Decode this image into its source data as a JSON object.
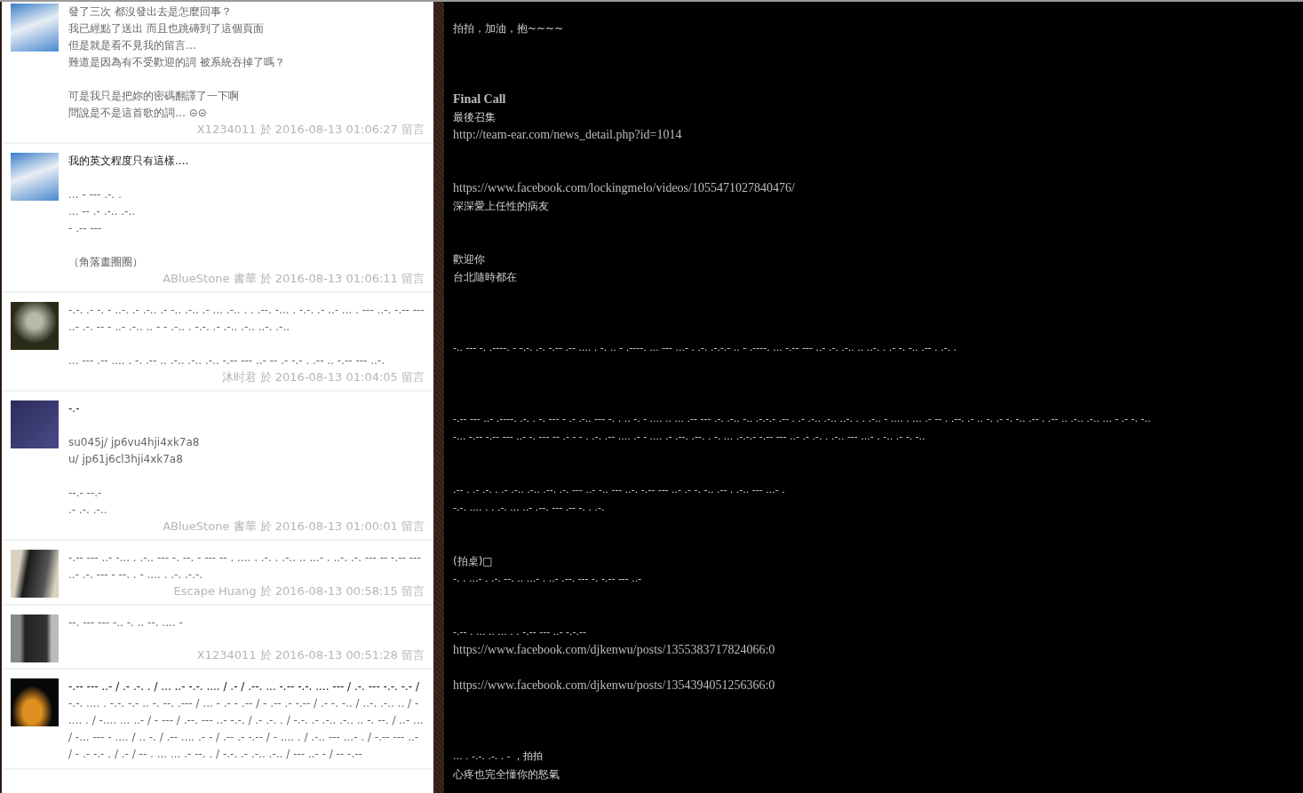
{
  "comments": [
    {
      "paragraphs": [
        {
          "dark": false,
          "lines": [
            "發了三次 都沒發出去是怎麼回事？",
            "我已經點了送出 而且也跳磚到了這個頁面",
            "但是就是看不見我的留言…",
            "難道是因為有不受歡迎的詞 被系統吞掉了嗎？"
          ]
        },
        {
          "dark": false,
          "lines": [
            "可是我只是把妳的密碼翻譯了一下啊",
            "問說是不是這首歌的詞… ⊝⊝"
          ]
        }
      ],
      "meta": "X1234011 於 2016-08-13 01:06:27 留言"
    },
    {
      "paragraphs": [
        {
          "dark": true,
          "lines": [
            "我的英文程度只有這樣...."
          ]
        },
        {
          "dark": false,
          "lines": [
            "... - --- .-. .",
            "... -- .- .-.. .-..",
            "- .-- ---"
          ]
        },
        {
          "dark": false,
          "lines": [
            "（角落畫圈圈）"
          ]
        }
      ],
      "meta": "ABlueStone 書華 於 2016-08-13 01:06:11 留言"
    },
    {
      "paragraphs": [
        {
          "dark": false,
          "lines": [
            "-.-. .- -. - ..-. .- .-.. .- -.. .-.. .- ... .-.. . . .--. -... . -.-. .- ..- ... . --- ..-. -.-- --- ..- .-. -- - ..- .-.. .. - - .-.. . -.-. .- .-.. .-.. ..-. .-.."
          ]
        },
        {
          "dark": false,
          "lines": [
            "... --- .-- .... . -. .-- .. .-.. .-.. .-.. -.-- --- ..- -- .- -.- . .-- .. -.-- --- ..-."
          ]
        }
      ],
      "meta": "沐时君 於 2016-08-13 01:04:05 留言"
    },
    {
      "paragraphs": [
        {
          "dark": true,
          "lines": [
            "-.-"
          ]
        },
        {
          "dark": false,
          "lines": [
            "su045j/ jp6vu4hji4xk7a8",
            "u/ jp61j6cl3hji4xk7a8"
          ]
        },
        {
          "dark": false,
          "lines": [
            "--.- --.-",
            ".- .-. .-.."
          ]
        }
      ],
      "meta": "ABlueStone 書華 於 2016-08-13 01:00:01 留言"
    },
    {
      "paragraphs": [
        {
          "dark": false,
          "lines": [
            "-.-- --- ..- -... . .-.. --- -. --. - --- -- . .... . .-. . .-.. .. ...- . ..-. .-. --- -- -.-- --- ..- .-. --- - --. . - .... . .-. .-.-."
          ]
        }
      ],
      "meta": "Escape Huang 於 2016-08-13 00:58:15 留言"
    },
    {
      "paragraphs": [
        {
          "dark": false,
          "lines": [
            "--. --- --- -.. -. .. --. .... -"
          ]
        }
      ],
      "meta": "X1234011 於 2016-08-13 00:51:28 留言"
    },
    {
      "paragraphs": [
        {
          "dark": true,
          "lines": [
            "-.-- --- ..- / .- .-. . / ... ..- -.-. .... / .- / .--. ... -.-- -.-. .... --- / .-. --- -.-. -.- /"
          ]
        },
        {
          "kind": "inline",
          "dark": false,
          "lines": [
            "-.-. .... . -.-. -.- .. -. --. .--- / ... - .- - .-- / - .-- .- -.-- / .- -. -.. / ..-. .-.. .. / - .... . / -.... ... ..- / - --- / .--. --- ..- -.-. / .- .-. . / -.-. .- .-.. .-.. .. -. --. / ..- ... / -... --- - .... / .. -. / .-- .... .- - / .-- .- -.-- / - .... . / .-.. --- ...- . / -.-- --- ..- / - .- -.- . / .- / -- . ... ... .- --. . / -.-. .- .-.. .-.. / --- ..- - / -- -.--"
          ]
        }
      ]
    }
  ],
  "feed": [
    {
      "kind": "first",
      "lines": [
        {
          "kind": "text",
          "text": "拍拍，加油，抱~~~~"
        }
      ]
    },
    {
      "kind": "wide",
      "lines": [
        {
          "kind": "title",
          "text": "Final Call"
        },
        {
          "kind": "text",
          "text": "最後召集"
        },
        {
          "kind": "url",
          "text": "http://team-ear.com/news_detail.php?id=1014"
        }
      ]
    },
    {
      "kind": "medium",
      "lines": [
        {
          "kind": "url",
          "text": "https://www.facebook.com/lockingmelo/videos/1055471027840476/"
        },
        {
          "kind": "text",
          "text": "深深愛上任性的病友"
        }
      ]
    },
    {
      "kind": "medium",
      "lines": [
        {
          "kind": "text",
          "text": "歡迎你"
        },
        {
          "kind": "text",
          "text": "台北隨時都在"
        }
      ]
    },
    {
      "kind": "wide",
      "lines": [
        {
          "kind": "morse",
          "text": "-.. --- -. .----. - -.-. .-. -.-- .-- .... . -. .. - .----. ... --- ...- . .-. .-.-.- .. - .----. ... -.-- --- ..- .-. .-.. .. ..-. . .- -. -.. .-- . .-. ."
        }
      ]
    },
    {
      "kind": "wide",
      "lines": [
        {
          "kind": "morse",
          "text": "-.-- --- ..- .----. .-. . -. --- - .- .-.. --- -. . .. -. - .... .. ... .-- --- .-. .-.. -.. .-.-.- .-- . .- .-.. .-.. ..-. . . .-.. - .... . ... .- -- . .--. .- .. -. .- -. -.. .-- . .-- .. .-.. .-.. ... - .- -. -.. -... -.-- -.-- --- ..- -. --- -- .- - - . .-. .-- .... .- - .... .- .--. .--. . -. ... .-.-.- -.-- --- ..- .- .-. . .-.. --- ...- . -.. .- -. -.."
        }
      ]
    },
    {
      "kind": "medium",
      "lines": [
        {
          "kind": "morse",
          "text": ".-- . .- .-. . .- .-.. .-.. .--. .-. --- ..- -.. --- ..-. -.-- --- ..- .- -. -.. .-- . .-.. --- ...- ."
        },
        {
          "kind": "morse",
          "text": "-.-. .... . . .-. ... ..- .--. --- .-- -. . .-."
        }
      ]
    },
    {
      "kind": "medium",
      "lines": [
        {
          "kind": "text",
          "text": "(拍桌)□"
        },
        {
          "kind": "morse",
          "text": "-. . ...- . .-. --. .. ...- . ..- .--. --- -. -.-- --- ..-"
        }
      ]
    },
    {
      "kind": "medium",
      "lines": [
        {
          "kind": "morse",
          "text": "-.-- . ... .. ... . . -.-- --- ..- -.-.--"
        },
        {
          "kind": "url",
          "text": "https://www.facebook.com/djkenwu/posts/1355383717824066:0"
        }
      ]
    },
    {
      "kind": "narrow",
      "lines": [
        {
          "kind": "url",
          "text": "https://www.facebook.com/djkenwu/posts/1354394051256366:0"
        }
      ]
    },
    {
      "kind": "wide",
      "lines": [
        {
          "kind": "morse",
          "text": "... . -.-. .-. . - ，拍拍"
        },
        {
          "kind": "text",
          "text": "心疼也完全懂你的怒氣"
        }
      ]
    }
  ]
}
